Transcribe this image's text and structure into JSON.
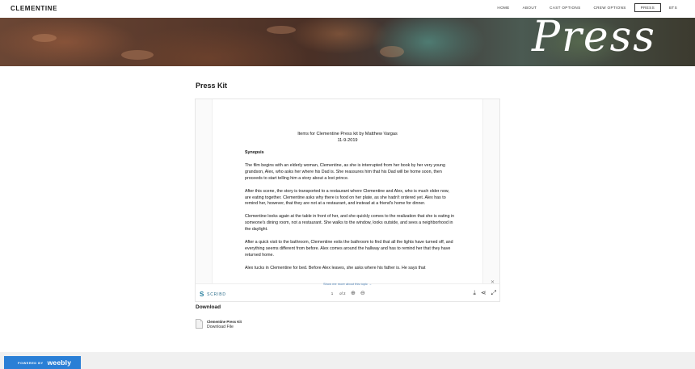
{
  "site": {
    "logo": "CLEMENTINE"
  },
  "nav": {
    "items": [
      "HOME",
      "ABOUT",
      "CAST OPTIONS",
      "CREW OPTIONS",
      "PRESS",
      "BTS"
    ],
    "active": "PRESS"
  },
  "hero": {
    "title": "Press"
  },
  "main": {
    "section_title": "Press Kit",
    "document": {
      "title_line1": "Items for Clementine Press kit by Matthew Vargas",
      "title_line2": "11-9-2019",
      "synopsis_heading": "Synopsis",
      "paragraphs": [
        "The film begins with an elderly woman, Clementine, as she is interrupted from her book by her very young grandson, Alex, who asks her where his Dad is. She reassures him that his Dad will be home soon, then proceeds to start telling him a story about a lost prince.",
        "After this scene, the story is transported to a restaurant where Clementine and Alex, who is much older now, are eating together. Clementine asks why there is food on her plate, as she hadn't ordered yet. Alex has to remind her, however, that they are not at a restaurant, and instead at a friend's home for dinner.",
        "Clementine looks again at the table in front of her, and she quickly comes to the realization that she is eating in someone's dining room, not a restaurant. She walks to the window, looks outside, and sees a neighborhood in the daylight.",
        "After a quick visit to the bathroom, Clementine exits the bathroom to find that all the lights have turned off, and everything seems different from before. Alex comes around the hallway and has to remind her that they have returned home.",
        "Alex tucks in Clementine for bed. Before Alex leaves, she asks where his father is. He says that"
      ]
    },
    "viewer": {
      "brand": "SCRIBD",
      "more_link": "Show me more about this topic →",
      "current_page": "1",
      "page_total": "of 2"
    },
    "download": {
      "title": "Download",
      "file_name": "Clementine Press Kit",
      "file_link": "Download File"
    }
  },
  "footer": {
    "powered_by": "POWERED BY",
    "brand": "weebly"
  },
  "colors": {
    "accent": "#2a7fd6",
    "scribd": "#1e7a9a"
  }
}
